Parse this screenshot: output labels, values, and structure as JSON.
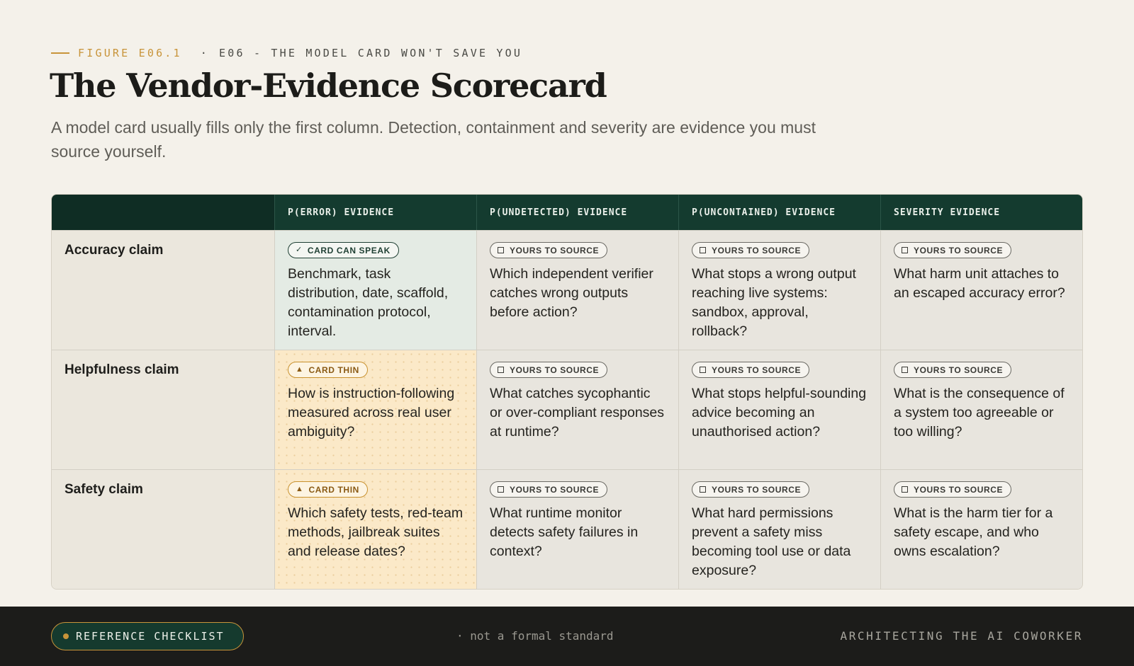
{
  "eyebrow": {
    "figure": "FIGURE E06.1",
    "separator": "·",
    "episode": "E06 - THE MODEL CARD WON'T SAVE YOU"
  },
  "title": "The Vendor-Evidence Scorecard",
  "subtitle": "A model card usually fills only the first column. Detection, containment and severity are evidence you must source yourself.",
  "table": {
    "columns": [
      "P(ERROR) EVIDENCE",
      "P(UNDETECTED) EVIDENCE",
      "P(UNCONTAINED) EVIDENCE",
      "SEVERITY EVIDENCE"
    ],
    "badges": {
      "speak": "CARD CAN SPEAK",
      "thin": "CARD THIN",
      "source": "YOURS TO SOURCE"
    },
    "rows": [
      {
        "label": "Accuracy claim",
        "cells": [
          "Benchmark, task distribution, date, scaffold, contamination protocol, interval.",
          "Which independent verifier catches wrong outputs before action?",
          "What stops a wrong output reaching live systems: sandbox, approval, rollback?",
          "What harm unit attaches to an escaped accuracy error?"
        ]
      },
      {
        "label": "Helpfulness claim",
        "cells": [
          "How is instruction-following measured across real user ambiguity?",
          "What catches sycophantic or over-compliant responses at runtime?",
          "What stops helpful-sounding advice becoming an unauthorised action?",
          "What is the consequence of a system too agreeable or too willing?"
        ]
      },
      {
        "label": "Safety claim",
        "cells": [
          "Which safety tests, red-team methods, jailbreak suites and release dates?",
          "What runtime monitor detects safety failures in context?",
          "What hard permissions prevent a safety miss becoming tool use or data exposure?",
          "What is the harm tier for a safety escape, and who owns escalation?"
        ]
      }
    ]
  },
  "footer": {
    "pill": "REFERENCE CHECKLIST",
    "note": "· not a formal standard",
    "brand": "ARCHITECTING THE AI COWORKER"
  }
}
